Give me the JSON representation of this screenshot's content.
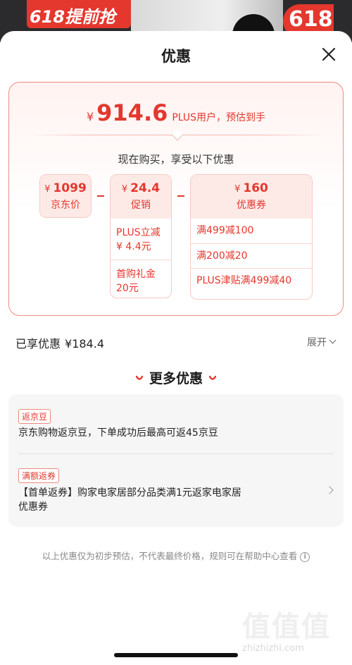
{
  "background": {
    "banner_text": "618提前抢",
    "badge_text": "618"
  },
  "sheet": {
    "title": "优惠",
    "close_icon": "close-icon"
  },
  "estimate": {
    "currency": "¥",
    "amount": "914.6",
    "note": "PLUS用户，预估到手"
  },
  "breakdown": {
    "subtitle": "现在购买，享受以下优惠",
    "jd_price": {
      "value": "1099",
      "label": "京东价"
    },
    "promotion": {
      "value": "24.4",
      "label": "促销",
      "details": [
        "PLUS立减\n¥ 4.4元",
        "首购礼金\n20元"
      ]
    },
    "coupon": {
      "value": "160",
      "label": "优惠券",
      "items": [
        "满499减100",
        "满200减20",
        "PLUS津贴满499减40"
      ]
    }
  },
  "enjoyed": {
    "label": "已享优惠",
    "amount": "¥184.4",
    "expand_label": "展开"
  },
  "more": {
    "title": "更多优惠",
    "items": [
      {
        "tag": "返京豆",
        "text": "京东购物返京豆，下单成功后最高可返45京豆"
      },
      {
        "tag": "满额返券",
        "text": "【首单返券】购家电家居部分品类满1元返家电家居\n优惠券"
      }
    ]
  },
  "disclaimer": "以上优惠仅为初步预估，不代表最终价格，规则可在帮助中心查看",
  "watermark": {
    "glyphs": "值值值",
    "url": "zhizhizhi.com"
  },
  "colors": {
    "accent": "#e4372e",
    "accent_light": "#fdeae7"
  }
}
